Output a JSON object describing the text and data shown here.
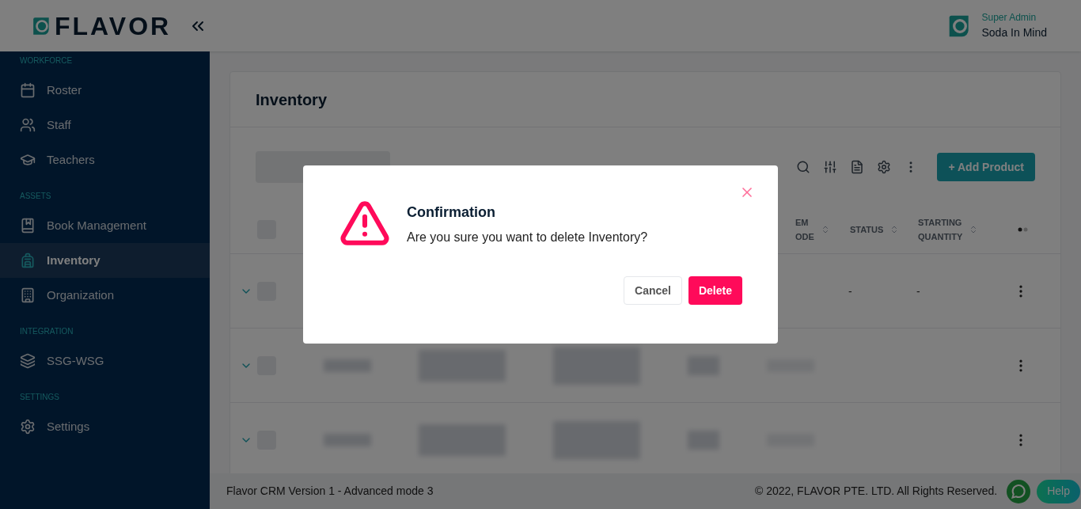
{
  "header": {
    "logo": "FLAVOR",
    "role": "Super Admin",
    "user": "Soda In Mind"
  },
  "sidebar": {
    "sections": [
      {
        "title": "WORKFORCE",
        "items": [
          {
            "label": "Roster",
            "selected": false
          },
          {
            "label": "Staff",
            "selected": false
          },
          {
            "label": "Teachers",
            "selected": false
          }
        ]
      },
      {
        "title": "ASSETS",
        "items": [
          {
            "label": "Book Management",
            "selected": false
          },
          {
            "label": "Inventory",
            "selected": true
          },
          {
            "label": "Organization",
            "selected": false
          }
        ]
      },
      {
        "title": "INTEGRATION",
        "items": [
          {
            "label": "SSG-WSG",
            "selected": false
          }
        ]
      },
      {
        "title": "SETTINGS",
        "items": [
          {
            "label": "Settings",
            "selected": false
          }
        ]
      }
    ]
  },
  "page": {
    "title": "Inventory",
    "tabs": [
      {
        "selected": true
      }
    ],
    "add_button": "+ Add Product",
    "table": {
      "select_all_checked": false,
      "columns": [
        {
          "lines": [
            "EM",
            "ODE"
          ]
        },
        {
          "lines": [
            "STATUS"
          ]
        },
        {
          "lines": [
            "STARTING",
            "QUANTITY"
          ]
        }
      ],
      "rows": [
        {
          "kind": "plain",
          "checked": false,
          "status": "-",
          "starting_quantity": "-"
        },
        {
          "kind": "blurred",
          "checked": false
        },
        {
          "kind": "blurred",
          "checked": false
        }
      ]
    }
  },
  "footer": {
    "version": "Flavor CRM Version 1 - Advanced mode 3",
    "copyright": "© 2022, FLAVOR PTE. LTD. All Rights Reserved.",
    "help": "Help"
  },
  "dialog": {
    "title": "Confirmation",
    "message": "Are you sure you want to delete Inventory?",
    "cancel": "Cancel",
    "confirm": "Delete"
  }
}
